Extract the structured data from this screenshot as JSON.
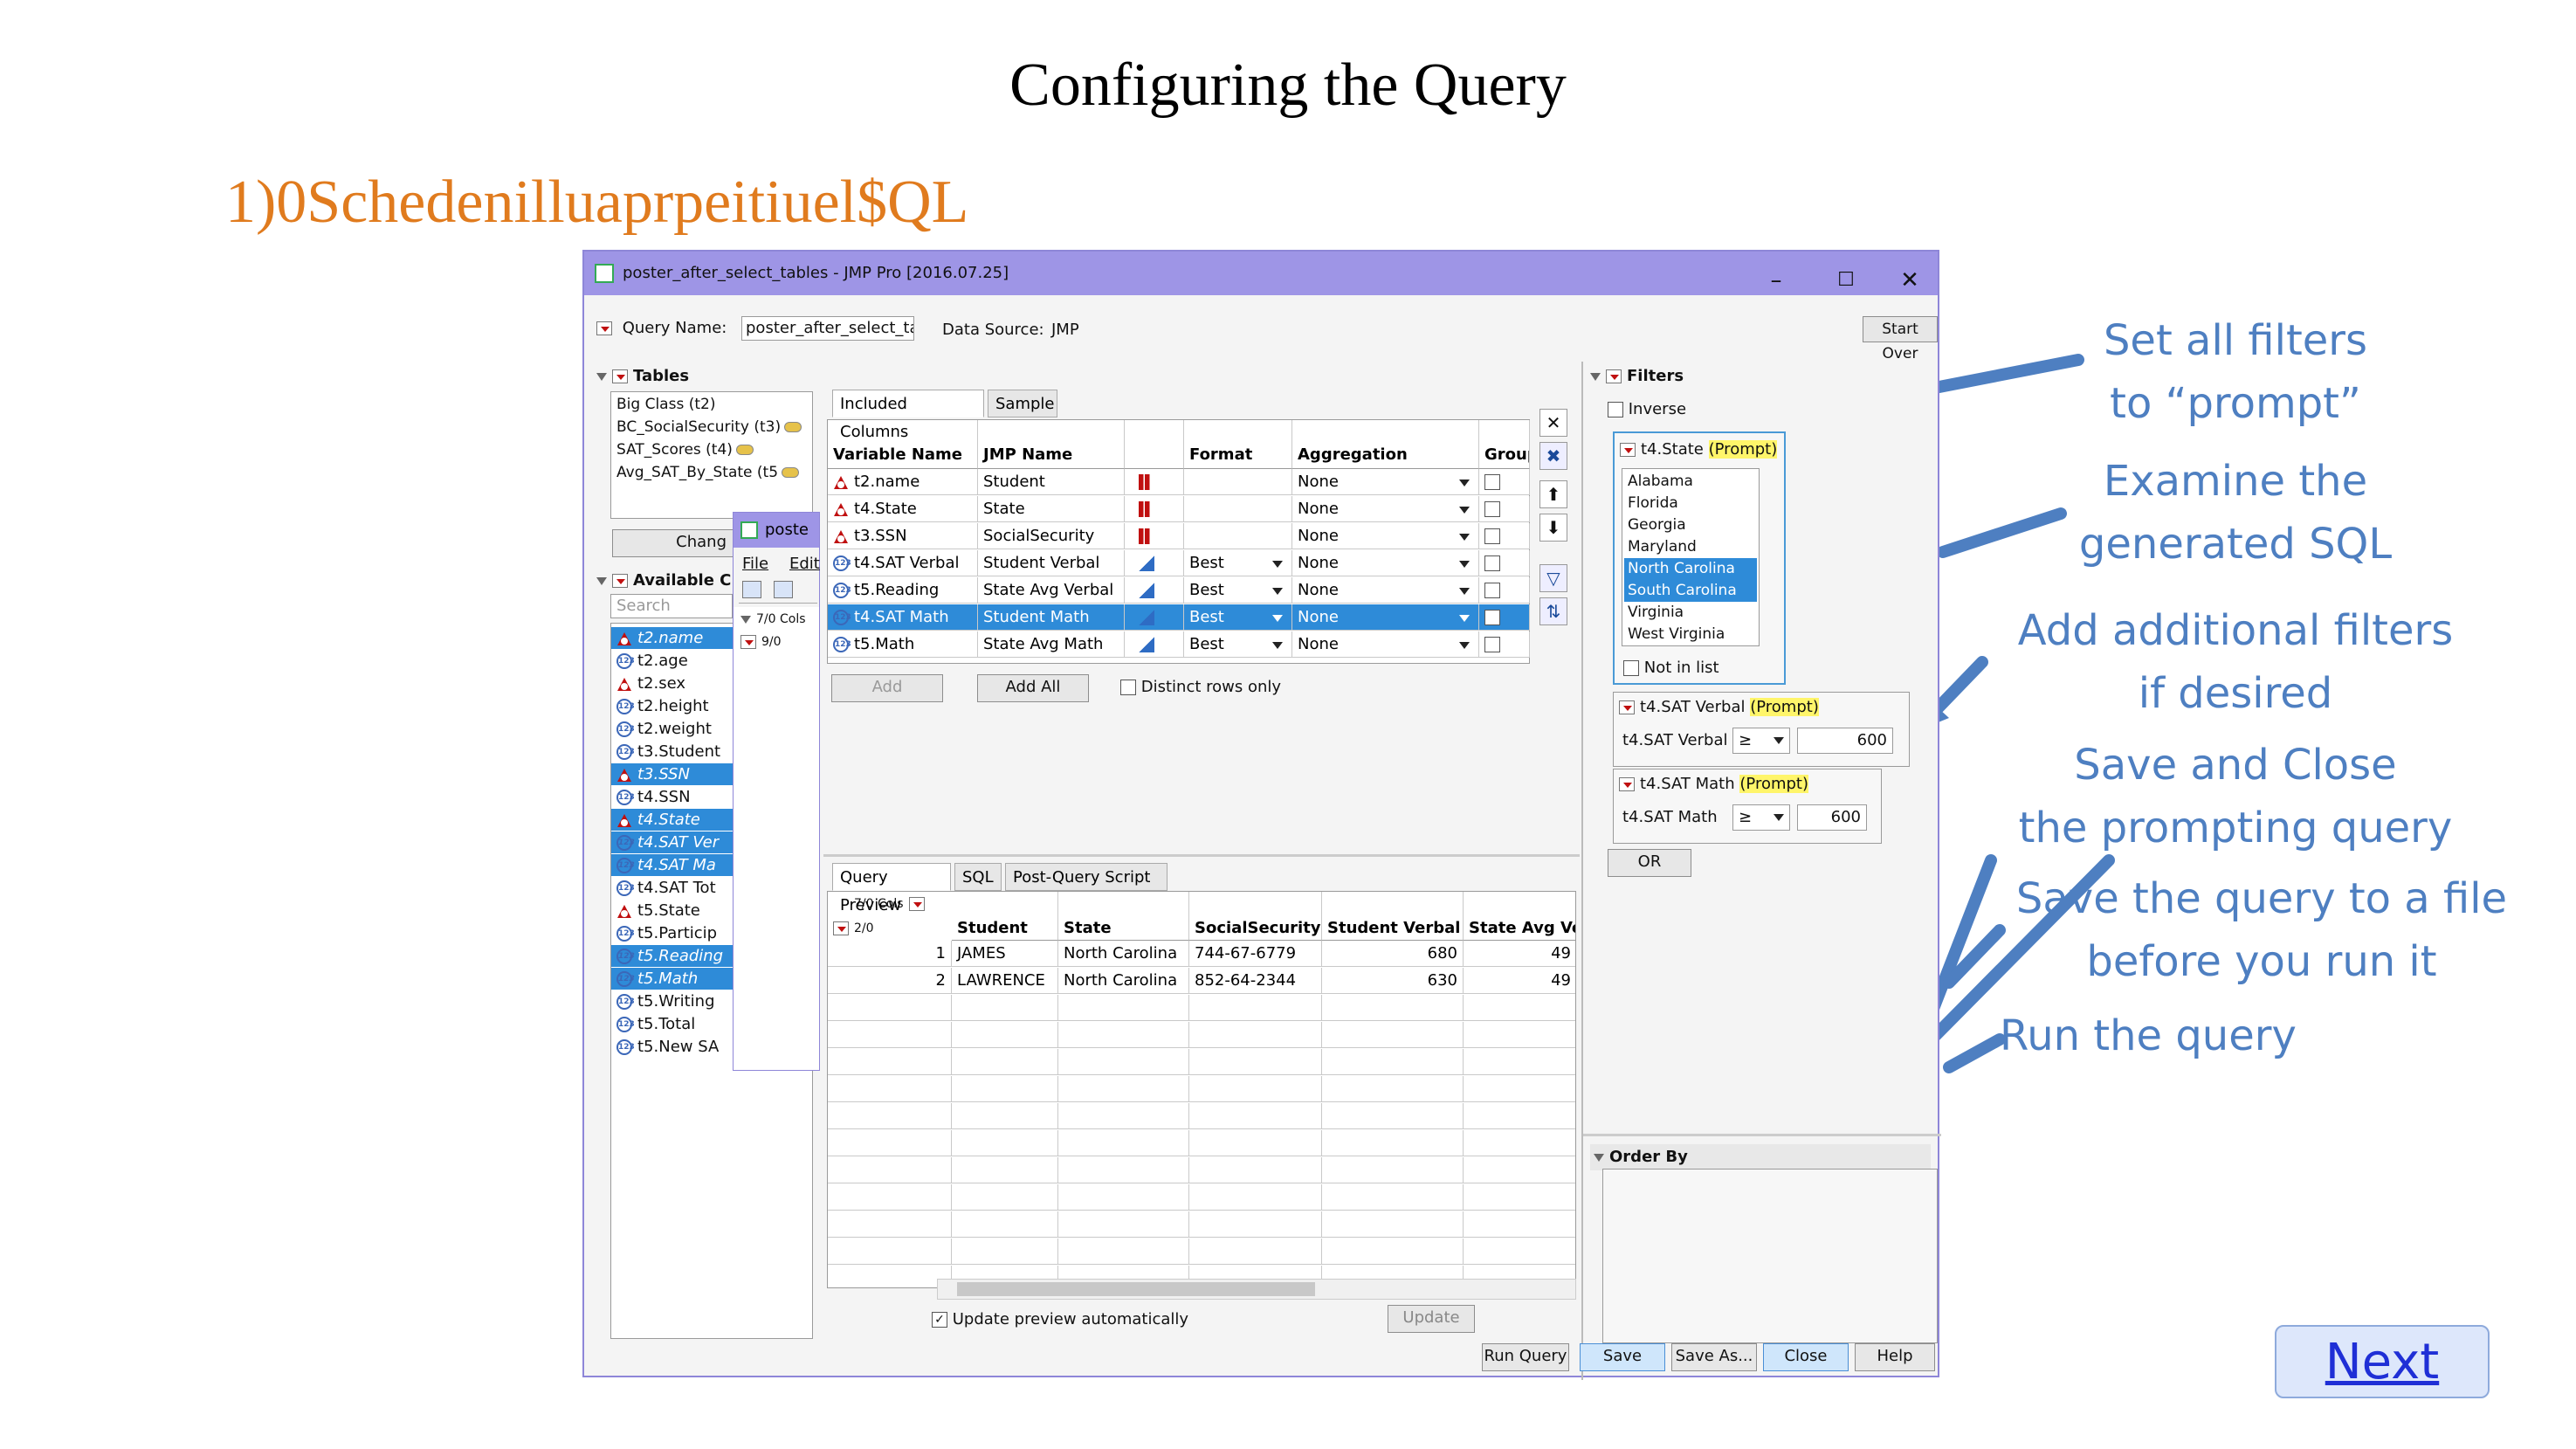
{
  "slide": {
    "title": "Configuring the Query",
    "overlap_text": "1)0Schedenilluaprpeitiuel$QL",
    "next_label": "Next"
  },
  "notes": [
    "Set all filters\nto “prompt”",
    "Examine the\ngenerated SQL",
    "Add additional filters\nif desired",
    "Save and Close\nthe prompting query",
    "Save the query to a file\nbefore you run it",
    "Run the query"
  ],
  "colors": {
    "accent": "#4e7fc1",
    "orange": "#e07b1e",
    "selection": "#2e8bd8",
    "titlebar": "#9e95e6"
  },
  "window": {
    "title": "poster_after_select_tables - JMP Pro [2016.07.25]",
    "query_name_label": "Query Name:",
    "query_name_value": "poster_after_select_tab",
    "data_source_label": "Data Source:",
    "data_source_value": "JMP",
    "start_over": "Start Over"
  },
  "tables": {
    "header": "Tables",
    "items": [
      "Big Class (t2)",
      "BC_SocialSecurity (t3)",
      "SAT_Scores (t4)",
      "Avg_SAT_By_State (t5"
    ],
    "change_btn": "Chang"
  },
  "available": {
    "header": "Available C",
    "search_placeholder": "Search",
    "items": [
      {
        "label": "t2.name",
        "type": "char",
        "sel": true
      },
      {
        "label": "t2.age",
        "type": "num",
        "sel": false
      },
      {
        "label": "t2.sex",
        "type": "char",
        "sel": false
      },
      {
        "label": "t2.height",
        "type": "num",
        "sel": false
      },
      {
        "label": "t2.weight",
        "type": "num",
        "sel": false
      },
      {
        "label": "t3.Student",
        "type": "num",
        "sel": false
      },
      {
        "label": "t3.SSN",
        "type": "char",
        "sel": true
      },
      {
        "label": "t4.SSN",
        "type": "num",
        "sel": false
      },
      {
        "label": "t4.State",
        "type": "char",
        "sel": true
      },
      {
        "label": "t4.SAT Ver",
        "type": "num",
        "sel": true
      },
      {
        "label": "t4.SAT Ma",
        "type": "num",
        "sel": true
      },
      {
        "label": "t4.SAT Tot",
        "type": "num",
        "sel": false
      },
      {
        "label": "t5.State",
        "type": "char",
        "sel": false
      },
      {
        "label": "t5.Particip",
        "type": "num",
        "sel": false
      },
      {
        "label": "t5.Reading",
        "type": "num",
        "sel": true
      },
      {
        "label": "t5.Math",
        "type": "num",
        "sel": true
      },
      {
        "label": "t5.Writing",
        "type": "num",
        "sel": false
      },
      {
        "label": "t5.Total",
        "type": "num",
        "sel": false
      },
      {
        "label": "t5.New SA",
        "type": "num",
        "sel": false
      }
    ]
  },
  "sub_window": {
    "title": "poste",
    "menu_file": "File",
    "menu_edit": "Edit",
    "cols_label": "7/0 Cols",
    "rows_label": "9/0"
  },
  "included": {
    "tabs": [
      "Included Columns",
      "Sample"
    ],
    "headers": [
      "Variable Name",
      "JMP Name",
      "",
      "Format",
      "Aggregation",
      "Group By"
    ],
    "rows": [
      {
        "var": "t2.name",
        "jmp": "Student",
        "type": "char",
        "fmt": "",
        "agg": "None",
        "sel": false
      },
      {
        "var": "t4.State",
        "jmp": "State",
        "type": "char",
        "fmt": "",
        "agg": "None",
        "sel": false
      },
      {
        "var": "t3.SSN",
        "jmp": "SocialSecurity",
        "type": "char",
        "fmt": "",
        "agg": "None",
        "sel": false
      },
      {
        "var": "t4.SAT Verbal",
        "jmp": "Student Verbal",
        "type": "num",
        "fmt": "Best",
        "agg": "None",
        "sel": false
      },
      {
        "var": "t5.Reading",
        "jmp": "State Avg Verbal",
        "type": "num",
        "fmt": "Best",
        "agg": "None",
        "sel": false
      },
      {
        "var": "t4.SAT Math",
        "jmp": "Student Math",
        "type": "num",
        "fmt": "Best",
        "agg": "None",
        "sel": true
      },
      {
        "var": "t5.Math",
        "jmp": "State Avg Math",
        "type": "num",
        "fmt": "Best",
        "agg": "None",
        "sel": false
      }
    ],
    "add": "Add",
    "add_all": "Add All",
    "distinct": "Distinct rows only"
  },
  "preview": {
    "tabs": [
      "Query Preview",
      "SQL",
      "Post-Query Script"
    ],
    "cols_label": "7/0 Cols",
    "rows_label": "2/0",
    "headers": [
      "Student",
      "State",
      "SocialSecurity",
      "Student Verbal",
      "State Avg Verbal"
    ],
    "rows": [
      {
        "n": "1",
        "c": [
          "JAMES",
          "North Carolina",
          "744-67-6779",
          "680",
          "49"
        ]
      },
      {
        "n": "2",
        "c": [
          "LAWRENCE",
          "North Carolina",
          "852-64-2344",
          "630",
          "49"
        ]
      }
    ],
    "update_auto": "Update preview automatically",
    "update": "Update"
  },
  "filters": {
    "header": "Filters",
    "inverse": "Inverse",
    "prompt": "(Prompt)",
    "state_title": "t4.State",
    "states": [
      "Alabama",
      "Florida",
      "Georgia",
      "Maryland",
      "North Carolina",
      "South Carolina",
      "Virginia",
      "West Virginia"
    ],
    "states_sel": [
      "North Carolina",
      "South Carolina"
    ],
    "not_in_list": "Not in list",
    "verbal_title": "t4.SAT Verbal",
    "verbal_label": "t4.SAT Verbal",
    "verbal_op": "≥",
    "verbal_val": "600",
    "math_title": "t4.SAT Math",
    "math_label": "t4.SAT Math",
    "math_op": "≥",
    "math_val": "600",
    "or": "OR"
  },
  "order_by": {
    "header": "Order By"
  },
  "bottom": {
    "run_query": "Run Query",
    "save": "Save",
    "save_as": "Save As...",
    "close": "Close",
    "help": "Help"
  }
}
